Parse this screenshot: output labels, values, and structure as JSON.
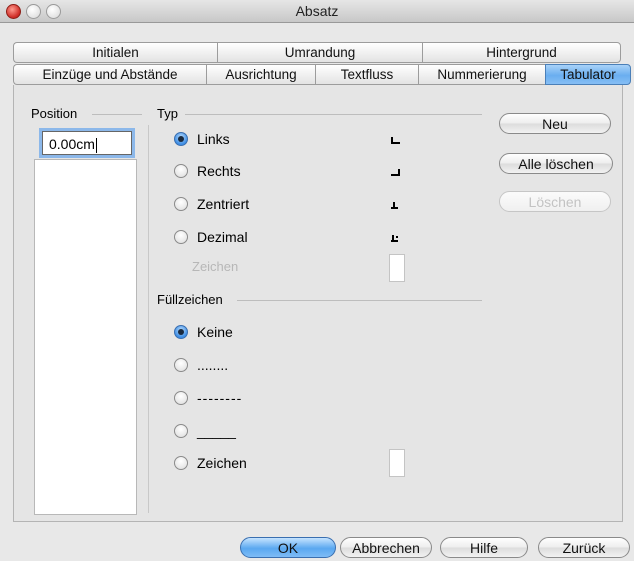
{
  "window": {
    "title": "Absatz"
  },
  "tabs_row1": [
    {
      "label": "Initialen"
    },
    {
      "label": "Umrandung"
    },
    {
      "label": "Hintergrund"
    }
  ],
  "tabs_row2": [
    {
      "label": "Einzüge und Abstände"
    },
    {
      "label": "Ausrichtung"
    },
    {
      "label": "Textfluss"
    },
    {
      "label": "Nummerierung"
    },
    {
      "label": "Tabulator",
      "active": true
    }
  ],
  "position": {
    "label": "Position",
    "value": "0.00cm"
  },
  "typ": {
    "label": "Typ",
    "options": [
      {
        "label": "Links",
        "selected": true,
        "glyph": "tab-left-icon"
      },
      {
        "label": "Rechts",
        "selected": false,
        "glyph": "tab-right-icon"
      },
      {
        "label": "Zentriert",
        "selected": false,
        "glyph": "tab-center-icon"
      },
      {
        "label": "Dezimal",
        "selected": false,
        "glyph": "tab-decimal-icon"
      }
    ],
    "zeichen_label": "Zeichen"
  },
  "fuellzeichen": {
    "label": "Füllzeichen",
    "options": [
      {
        "label": "Keine",
        "selected": true
      },
      {
        "label": "........",
        "selected": false
      },
      {
        "label": "--------",
        "selected": false
      },
      {
        "label": "_____",
        "selected": false
      },
      {
        "label": "Zeichen",
        "selected": false
      }
    ]
  },
  "side_buttons": {
    "new": "Neu",
    "delete_all": "Alle löschen",
    "delete": "Löschen"
  },
  "footer_buttons": {
    "ok": "OK",
    "cancel": "Abbrechen",
    "help": "Hilfe",
    "back": "Zurück"
  },
  "colors": {
    "accent": "#6aaef0",
    "focus_ring": "#8cb8ea",
    "close_light": "#d0302a"
  }
}
